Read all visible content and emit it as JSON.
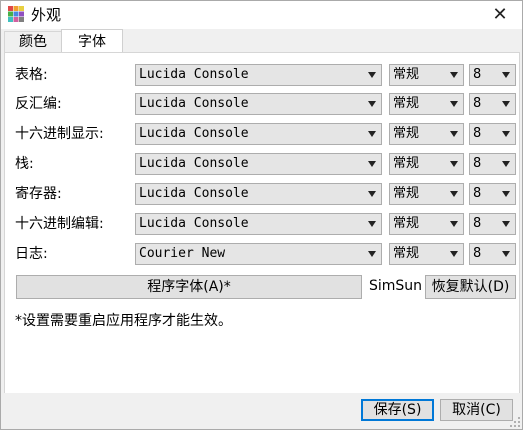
{
  "window": {
    "title": "外观",
    "close_glyph": "✕"
  },
  "tabs": [
    {
      "label": "颜色",
      "selected": false
    },
    {
      "label": "字体",
      "selected": true
    }
  ],
  "font_rows": [
    {
      "label": "表格:",
      "font": "Lucida Console",
      "style": "常规",
      "size": "8"
    },
    {
      "label": "反汇编:",
      "font": "Lucida Console",
      "style": "常规",
      "size": "8"
    },
    {
      "label": "十六进制显示:",
      "font": "Lucida Console",
      "style": "常规",
      "size": "8"
    },
    {
      "label": "栈:",
      "font": "Lucida Console",
      "style": "常规",
      "size": "8"
    },
    {
      "label": "寄存器:",
      "font": "Lucida Console",
      "style": "常规",
      "size": "8"
    },
    {
      "label": "十六进制编辑:",
      "font": "Lucida Console",
      "style": "常规",
      "size": "8"
    },
    {
      "label": "日志:",
      "font": "Courier New",
      "style": "常规",
      "size": "8"
    }
  ],
  "program_font_button": "程序字体(A)*",
  "program_font_value": "SimSun",
  "restore_defaults_button": "恢复默认(D)",
  "note": "*设置需要重启应用程序才能生效。",
  "footer": {
    "save_label": "保存(S)",
    "cancel_label": "取消(C)"
  },
  "colors": {
    "accent": "#0078d7",
    "button_face": "#e1e1e1",
    "combo_face": "#e5e5e5",
    "border": "#adadad"
  }
}
